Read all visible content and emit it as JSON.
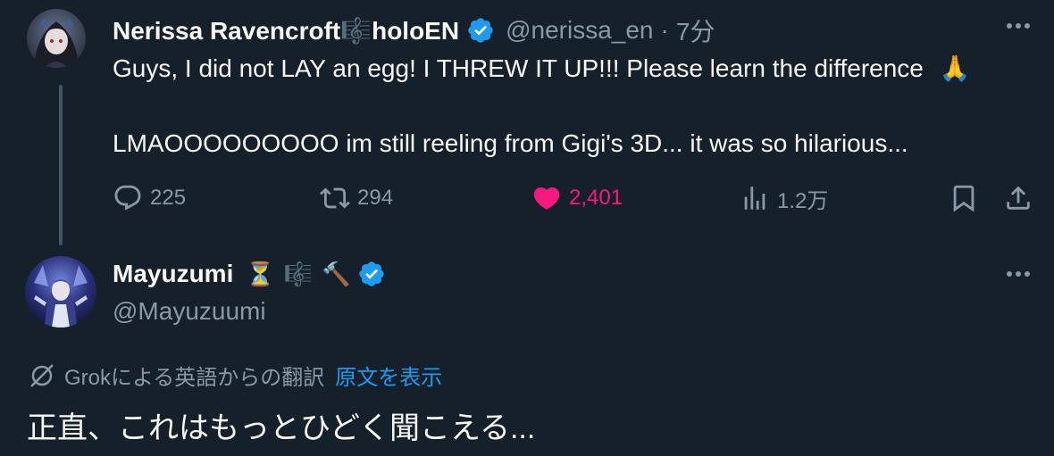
{
  "colors": {
    "background": "#15202b",
    "text_primary": "#f7f9f9",
    "text_secondary": "#8b98a5",
    "link": "#1d9bf0",
    "like": "#f91880",
    "verified": "#1d9bf0",
    "thread_line": "#425364"
  },
  "tweet1": {
    "display_name": "Nerissa Ravencroft🎼holoEN",
    "verified_icon": "verified-badge-icon",
    "handle": "@nerissa_en",
    "separator": "·",
    "time": "7分",
    "text_line1": "Guys, I did not LAY an egg! I THREW IT UP!!! Please learn the difference",
    "text_line1_emoji": "🙏",
    "text_line2": "LMAOOOOOOOOO im still reeling from Gigi's 3D... it was so hilarious...",
    "actions": {
      "replies": "225",
      "reposts": "294",
      "likes": "2,401",
      "views": "1.2万"
    }
  },
  "tweet2": {
    "display_name": "Mayuzumi",
    "name_emojis": [
      "⏳",
      "🎼",
      "🔨"
    ],
    "verified_icon": "verified-badge-icon",
    "handle": "@Mayuzuumi",
    "translation_label": "Grokによる英語からの翻訳",
    "show_original": "原文を表示",
    "translated_text": "正直、これはもっとひどく聞こえる..."
  }
}
